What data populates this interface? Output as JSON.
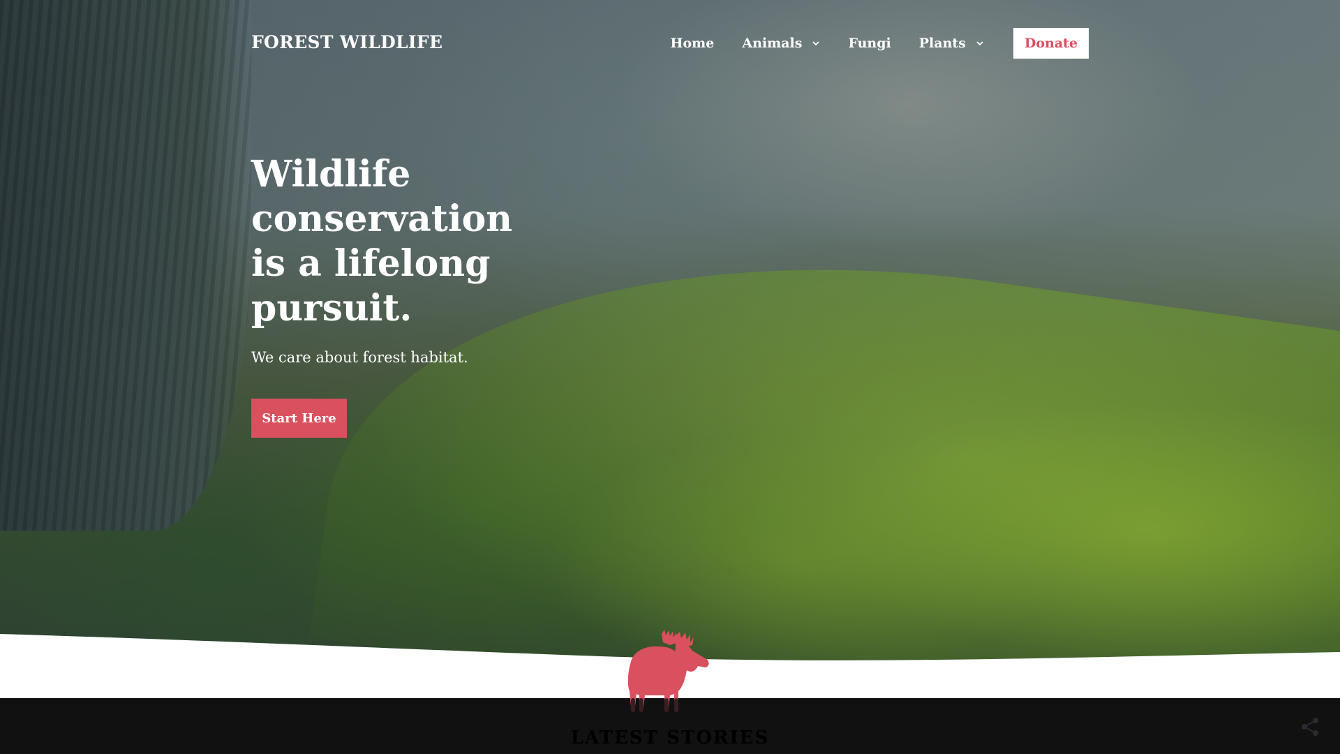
{
  "header": {
    "brand": "FOREST WILDLIFE",
    "nav": [
      {
        "label": "Home",
        "has_dropdown": false
      },
      {
        "label": "Animals",
        "has_dropdown": true
      },
      {
        "label": "Fungi",
        "has_dropdown": false
      },
      {
        "label": "Plants",
        "has_dropdown": true
      }
    ],
    "donate_label": "Donate"
  },
  "hero": {
    "title": "Wildlife conservation is a lifelong pursuit.",
    "subtitle": "We care about forest habitat.",
    "cta_label": "Start Here"
  },
  "latest": {
    "heading": "LATEST STORIES"
  },
  "icons": {
    "dropdown": "chevron-down-icon",
    "mascot": "moose-icon",
    "share": "share-icon"
  },
  "colors": {
    "accent": "#d9505f",
    "text_light": "#ffffff",
    "dark_band": "#111111"
  }
}
